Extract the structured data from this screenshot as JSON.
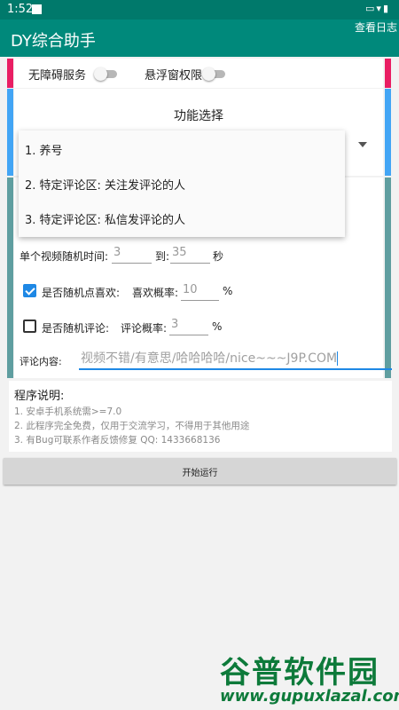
{
  "status_bar": {
    "time": "1:52"
  },
  "app_bar": {
    "title": "DY综合助手",
    "log_button": "查看日志"
  },
  "toggles": {
    "accessibility": {
      "label": "无障碍服务",
      "on": false
    },
    "floating_window": {
      "label": "悬浮窗权限",
      "on": false
    }
  },
  "function_select": {
    "title": "功能选择",
    "options": [
      "1. 养号",
      "2. 特定评论区: 关注发评论的人",
      "3. 特定评论区: 私信发评论的人"
    ]
  },
  "settings": {
    "video_time": {
      "label": "单个视频随机时间:",
      "from_placeholder": "3",
      "to_label": "到:",
      "to_placeholder": "35",
      "unit": "秒"
    },
    "random_like": {
      "checked": true,
      "label": "是否随机点喜欢:",
      "rate_label": "喜欢概率:",
      "rate_placeholder": "10",
      "unit": "%"
    },
    "random_comment": {
      "checked": false,
      "label": "是否随机评论:",
      "rate_label": "评论概率:",
      "rate_placeholder": "3",
      "unit": "%"
    },
    "comment_content": {
      "label": "评论内容:",
      "placeholder": "视频不错/有意思/哈哈哈哈/nice~~~J9P.COM"
    }
  },
  "description": {
    "title": "程序说明:",
    "lines": [
      "1. 安卓手机系统需>=7.0",
      "2. 此程序完全免费，仅用于交流学习，不得用于其他用途",
      "3. 有Bug可联系作者反馈修复 QQ: 1433668136"
    ]
  },
  "run_button": "开始运行",
  "watermark": {
    "title": "谷普软件园",
    "url": "www.gupuxlazal.com"
  },
  "colors": {
    "primary": "#00897b",
    "stripe_pink": "#e91e63",
    "stripe_blue": "#42a5f5",
    "stripe_teal": "#5f9ea0",
    "accent": "#1e88e5"
  }
}
